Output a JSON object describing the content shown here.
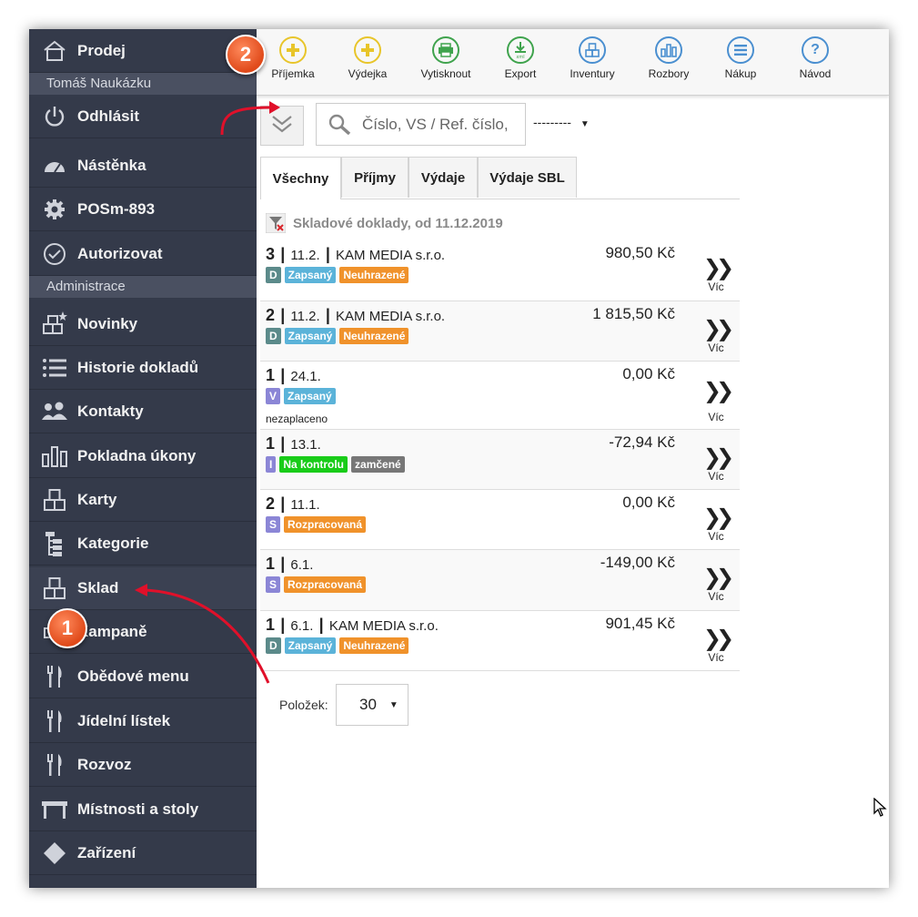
{
  "sidebar": {
    "items": [
      {
        "label": "Prodej",
        "icon": "home-icon"
      },
      {
        "label": "Odhlásit",
        "icon": "power-icon"
      },
      {
        "label": "Nástěnka",
        "icon": "dashboard-gauge-icon"
      },
      {
        "label": "POSm-893",
        "icon": "gear-icon"
      },
      {
        "label": "Autorizovat",
        "icon": "check-circle-icon"
      },
      {
        "label": "Novinky",
        "icon": "boxes-star-icon"
      },
      {
        "label": "Historie dokladů",
        "icon": "list-icon"
      },
      {
        "label": "Kontakty",
        "icon": "users-icon"
      },
      {
        "label": "Pokladna úkony",
        "icon": "bars-icon"
      },
      {
        "label": "Karty",
        "icon": "boxes-icon"
      },
      {
        "label": "Kategorie",
        "icon": "tree-icon"
      },
      {
        "label": "Sklad",
        "icon": "boxes-icon"
      },
      {
        "label": "Kampaně",
        "icon": "campaign-icon"
      },
      {
        "label": "Obědové menu",
        "icon": "cutlery-icon"
      },
      {
        "label": "Jídelní lístek",
        "icon": "cutlery-icon"
      },
      {
        "label": "Rozvoz",
        "icon": "cutlery-icon"
      },
      {
        "label": "Místnosti a stoly",
        "icon": "table-icon"
      },
      {
        "label": "Zařízení",
        "icon": "diamond-icon"
      }
    ],
    "user_name": "Tomáš Naukázku",
    "admin_header": "Administrace"
  },
  "toolbar": {
    "buttons": [
      {
        "label": "Příjemka",
        "icon": "plus-circle-icon",
        "color": "#e8c52a"
      },
      {
        "label": "Výdejka",
        "icon": "plus-circle-icon",
        "color": "#e8c52a"
      },
      {
        "label": "Vytisknout",
        "icon": "print-icon",
        "color": "#3fa34d"
      },
      {
        "label": "Export",
        "icon": "download-xml-icon",
        "color": "#3fa34d"
      },
      {
        "label": "Inventury",
        "icon": "boxes-icon",
        "color": "#4a8fd0"
      },
      {
        "label": "Rozbory",
        "icon": "chart-icon",
        "color": "#4a8fd0"
      },
      {
        "label": "Nákup",
        "icon": "list-circle-icon",
        "color": "#4a8fd0"
      },
      {
        "label": "Návod",
        "icon": "question-icon",
        "color": "#4a8fd0"
      }
    ]
  },
  "search": {
    "placeholder": "Číslo, VS / Ref. číslo,",
    "value": ""
  },
  "filter_select": {
    "selected": "---------"
  },
  "tabs": [
    {
      "label": "Všechny",
      "active": true
    },
    {
      "label": "Příjmy",
      "active": false
    },
    {
      "label": "Výdaje",
      "active": false
    },
    {
      "label": "Výdaje SBL",
      "active": false
    }
  ],
  "list_title": "Skladové doklady, od 11.12.2019",
  "rows": [
    {
      "count": "3",
      "date": "11.2.",
      "partner": "KAM MEDIA s.r.o.",
      "amount": "980,50 Kč",
      "badges": [
        {
          "text": "D",
          "color": "#5b8a8a"
        },
        {
          "text": "Zapsaný",
          "color": "#5bb3d9"
        },
        {
          "text": "Neuhrazené",
          "color": "#f0922b"
        }
      ],
      "note": ""
    },
    {
      "count": "2",
      "date": "11.2.",
      "partner": "KAM MEDIA s.r.o.",
      "amount": "1 815,50 Kč",
      "badges": [
        {
          "text": "D",
          "color": "#5b8a8a"
        },
        {
          "text": "Zapsaný",
          "color": "#5bb3d9"
        },
        {
          "text": "Neuhrazené",
          "color": "#f0922b"
        }
      ],
      "note": ""
    },
    {
      "count": "1",
      "date": "24.1.",
      "partner": "",
      "amount": "0,00 Kč",
      "badges": [
        {
          "text": "V",
          "color": "#8b86d6"
        },
        {
          "text": "Zapsaný",
          "color": "#5bb3d9"
        }
      ],
      "note": "nezaplaceno"
    },
    {
      "count": "1",
      "date": "13.1.",
      "partner": "",
      "amount": "-72,94 Kč",
      "badges": [
        {
          "text": "I",
          "color": "#8b86d6"
        },
        {
          "text": "Na kontrolu",
          "color": "#19cc19"
        },
        {
          "text": "zamčené",
          "color": "#777777"
        }
      ],
      "note": ""
    },
    {
      "count": "2",
      "date": "11.1.",
      "partner": "",
      "amount": "0,00 Kč",
      "badges": [
        {
          "text": "S",
          "color": "#8b86d6"
        },
        {
          "text": "Rozpracovaná",
          "color": "#f0922b"
        }
      ],
      "note": ""
    },
    {
      "count": "1",
      "date": "6.1.",
      "partner": "",
      "amount": "-149,00 Kč",
      "badges": [
        {
          "text": "S",
          "color": "#8b86d6"
        },
        {
          "text": "Rozpracovaná",
          "color": "#f0922b"
        }
      ],
      "note": ""
    },
    {
      "count": "1",
      "date": "6.1.",
      "partner": "KAM MEDIA s.r.o.",
      "amount": "901,45 Kč",
      "badges": [
        {
          "text": "D",
          "color": "#5b8a8a"
        },
        {
          "text": "Zapsaný",
          "color": "#5bb3d9"
        },
        {
          "text": "Neuhrazené",
          "color": "#f0922b"
        }
      ],
      "note": ""
    }
  ],
  "more_label": "Víc",
  "pagination": {
    "label": "Položek:",
    "value": "30"
  },
  "annotations": {
    "marker1": "1",
    "marker2": "2"
  },
  "colors": {
    "sidebar_bg": "#343a4a",
    "accent_marker": "#e8561f",
    "arrow": "#e0102a"
  }
}
